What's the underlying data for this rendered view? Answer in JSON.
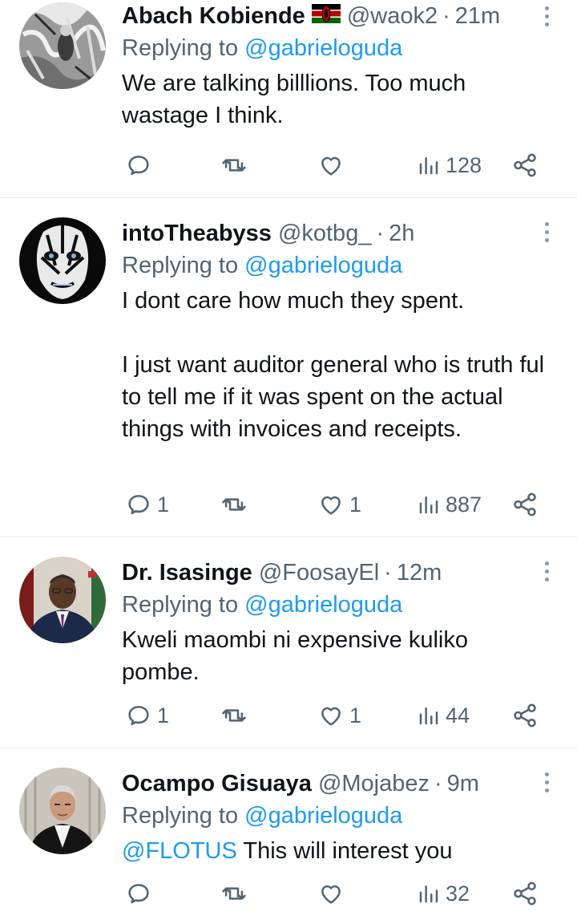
{
  "tweets": [
    {
      "name": "Abach Kobiende",
      "handle": "@waok2",
      "time": "21m",
      "replying_prefix": "Replying to",
      "replying_to": "@gabrieloguda",
      "mention": "",
      "text": "We are talking billlions. Too much wastage I think.",
      "replies": "",
      "likes": "",
      "views": "128",
      "avatar": "grayscale-sketch",
      "has_flag": true
    },
    {
      "name": "intoTheabyss",
      "handle": "@kotbg_",
      "time": "2h",
      "replying_prefix": "Replying to",
      "replying_to": "@gabrieloguda",
      "mention": "",
      "text": "I dont care how much they spent.\n\nI just want auditor general who is truth ful to tell me if it was spent on the actual things with invoices and receipts.",
      "replies": "1",
      "likes": "1",
      "views": "887",
      "avatar": "dark-mask"
    },
    {
      "name": "Dr. Isasinge",
      "handle": "@FoosayEl",
      "time": "12m",
      "replying_prefix": "Replying to",
      "replying_to": "@gabrieloguda",
      "mention": "",
      "text": "Kweli maombi ni expensive kuliko pombe.",
      "replies": "1",
      "likes": "1",
      "views": "44",
      "avatar": "man-in-suit"
    },
    {
      "name": "Ocampo Gisuaya",
      "handle": "@Mojabez",
      "time": "9m",
      "replying_prefix": "Replying to",
      "replying_to": "@gabrieloguda",
      "mention": "@FLOTUS",
      "text": " This will interest you",
      "replies": "",
      "likes": "",
      "views": "32",
      "avatar": "man-in-robe"
    }
  ],
  "separator": "·",
  "colors": {
    "link": "#1d9bf0",
    "muted": "#536471",
    "text": "#0f1419",
    "divider": "#e6e8ea"
  }
}
